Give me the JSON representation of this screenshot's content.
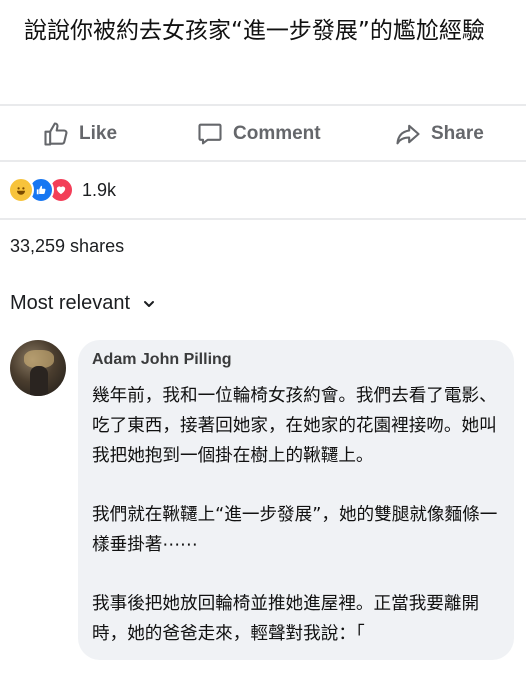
{
  "post": {
    "title": "說說你被約去女孩家“進一步發展”的尷尬經驗"
  },
  "actions": {
    "like": "Like",
    "comment": "Comment",
    "share": "Share"
  },
  "reactions": {
    "count": "1.9k",
    "icons": [
      "haha-icon",
      "like-icon",
      "love-icon"
    ]
  },
  "shares_text": "33,259 shares",
  "sort": {
    "label": "Most relevant"
  },
  "comment": {
    "author": "Adam John Pilling",
    "paragraphs": [
      "幾年前，我和一位輪椅女孩約會。我們去看了電影、吃了東西，接著回她家，在她家的花園裡接吻。她叫我把她抱到一個掛在樹上的鞦韆上。",
      "我們就在鞦韆上“進一步發展”，她的雙腿就像麵條一樣垂掛著⋯⋯",
      "我事後把她放回輪椅並推她進屋裡。正當我要離開時，她的爸爸走來，輕聲對我說：「"
    ]
  },
  "colors": {
    "text": "#1c1e21",
    "muted": "#65676b",
    "bubble": "#f0f2f5",
    "like_blue": "#1877f2",
    "love_red": "#f33e58",
    "haha_yellow": "#f7c33b"
  }
}
